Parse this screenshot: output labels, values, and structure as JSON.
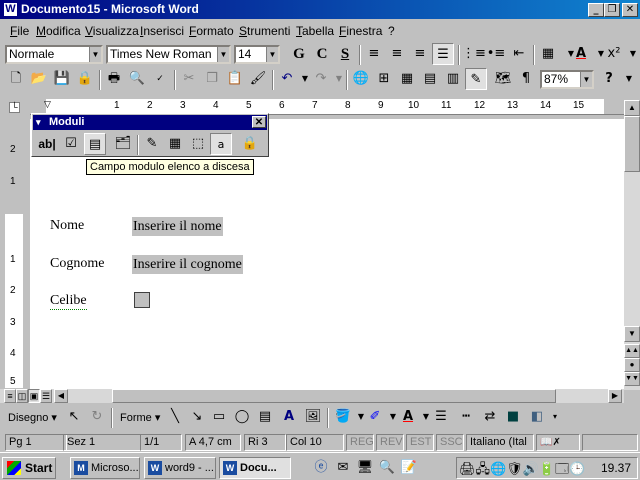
{
  "window": {
    "title": "Documento15 - Microsoft Word"
  },
  "menu": [
    "File",
    "Modifica",
    "Visualizza",
    "Inserisci",
    "Formato",
    "Strumenti",
    "Tabella",
    "Finestra",
    "?"
  ],
  "format_toolbar": {
    "style": "Normale",
    "font": "Times New Roman",
    "size": "14",
    "bold": "G",
    "italic": "C",
    "underline": "S"
  },
  "standard_toolbar": {
    "zoom": "87%"
  },
  "ruler": {
    "numbers": [
      "1",
      "2",
      "3",
      "4",
      "5",
      "6",
      "7",
      "8",
      "9",
      "10",
      "11",
      "12",
      "13",
      "14",
      "15"
    ]
  },
  "vruler": {
    "numbers": [
      "2",
      "1",
      "1",
      "2",
      "3",
      "4",
      "5"
    ]
  },
  "forms_palette": {
    "title": "Moduli",
    "text_field_icon": "ab|"
  },
  "tooltip": "Campo modulo elenco a discesa",
  "document": {
    "fields": [
      {
        "label": "Nome",
        "value": "Inserire il nome"
      },
      {
        "label": "Cognome",
        "value": "Inserire il cognome"
      },
      {
        "label": "Celibe",
        "value": ""
      }
    ]
  },
  "drawing_toolbar": {
    "draw": "Disegno",
    "shapes": "Forme"
  },
  "status": {
    "page": "Pg 1",
    "section": "Sez 1",
    "pages": "1/1",
    "at": "A 4,7 cm",
    "line": "Ri 3",
    "col": "Col 10",
    "modes": [
      "REG",
      "REV",
      "EST",
      "SSC"
    ],
    "language": "Italiano (Ital"
  },
  "taskbar": {
    "start": "Start",
    "tasks": [
      "Microso...",
      "word9 - ...",
      "Docu..."
    ],
    "clock": "19.37"
  }
}
